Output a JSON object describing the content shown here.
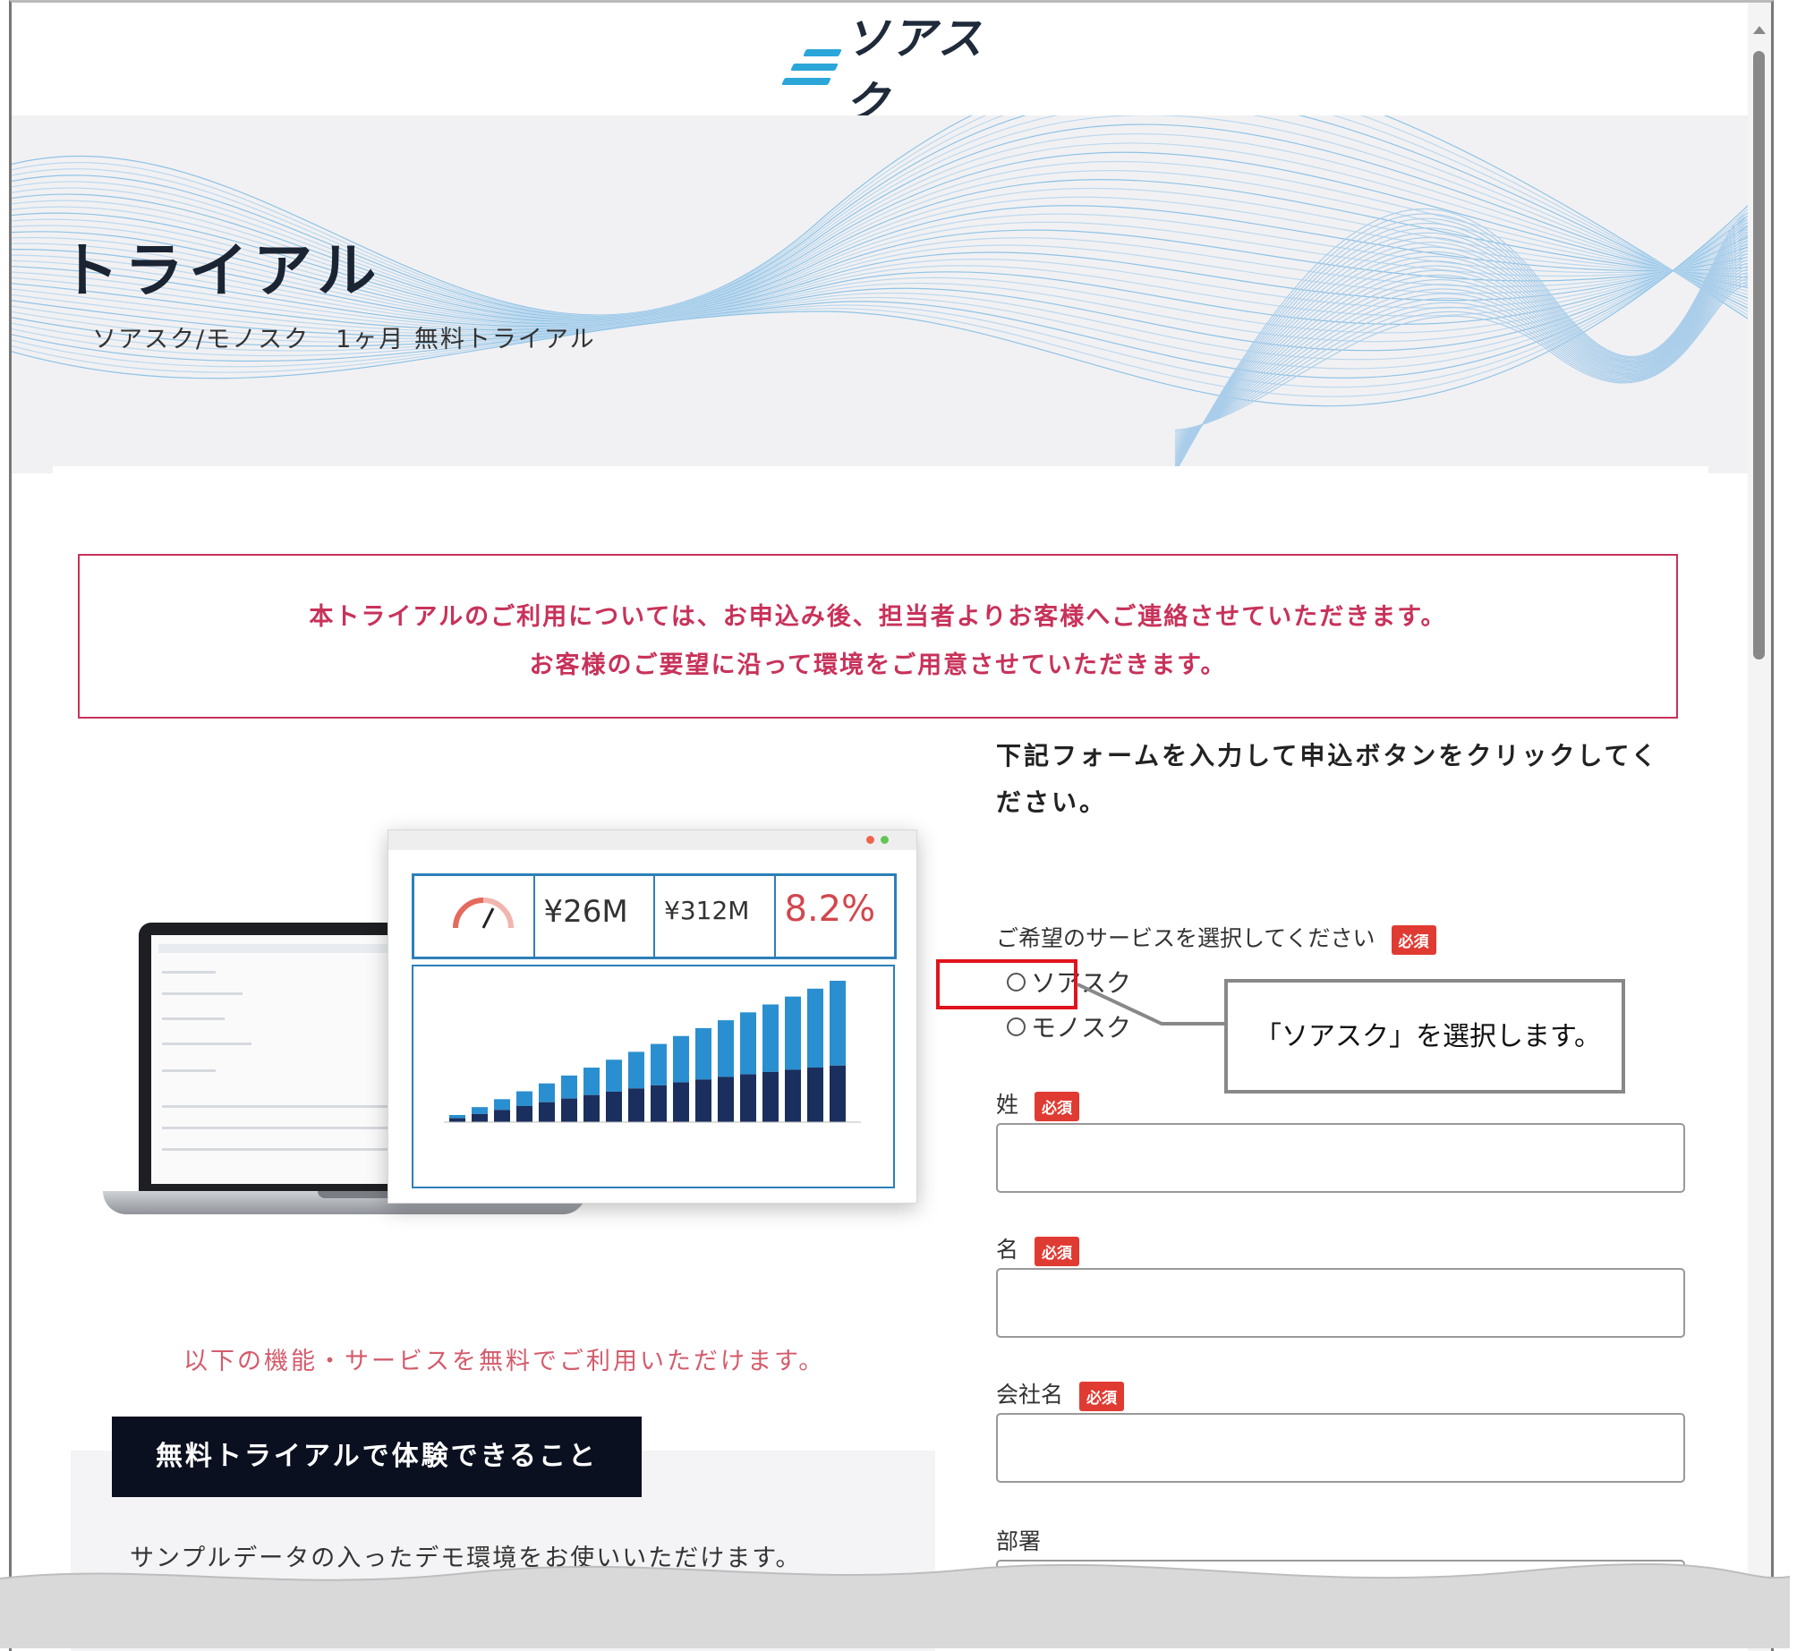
{
  "header": {
    "logo_text": "ソアスク",
    "logo_icon": "lines-logo-icon"
  },
  "hero": {
    "title": "トライアル",
    "subtitle": "ソアスク/モノスク　1ヶ月 無料トライアル"
  },
  "notice": {
    "line1": "本トライアルのご利用については、お申込み後、担当者よりお客様へご連絡させていただきます。",
    "line2": "お客様のご要望に沿って環境をご用意させていただきます。",
    "color": "#c8325a"
  },
  "promo": {
    "kpis": [
      "¥26M",
      "¥312M",
      "8.2%"
    ],
    "text": "以下の機能・サービスを無料でご利用いただけます。",
    "feature_label": "無料トライアルで体験できること",
    "feature_text": "サンプルデータの入ったデモ環境をお使いいただけます。"
  },
  "form": {
    "heading": "下記フォームを入力して申込ボタンをクリックしてください。",
    "required_badge": "必須",
    "service_label": "ご希望のサービスを選択してください",
    "service_options": [
      "ソアスク",
      "モノスク"
    ],
    "last_name_label": "姓",
    "first_name_label": "名",
    "company_label": "会社名",
    "department_label": "部署"
  },
  "annotation": {
    "callout_text": "「ソアスク」を選択します。",
    "highlight_color": "#e0141c"
  }
}
